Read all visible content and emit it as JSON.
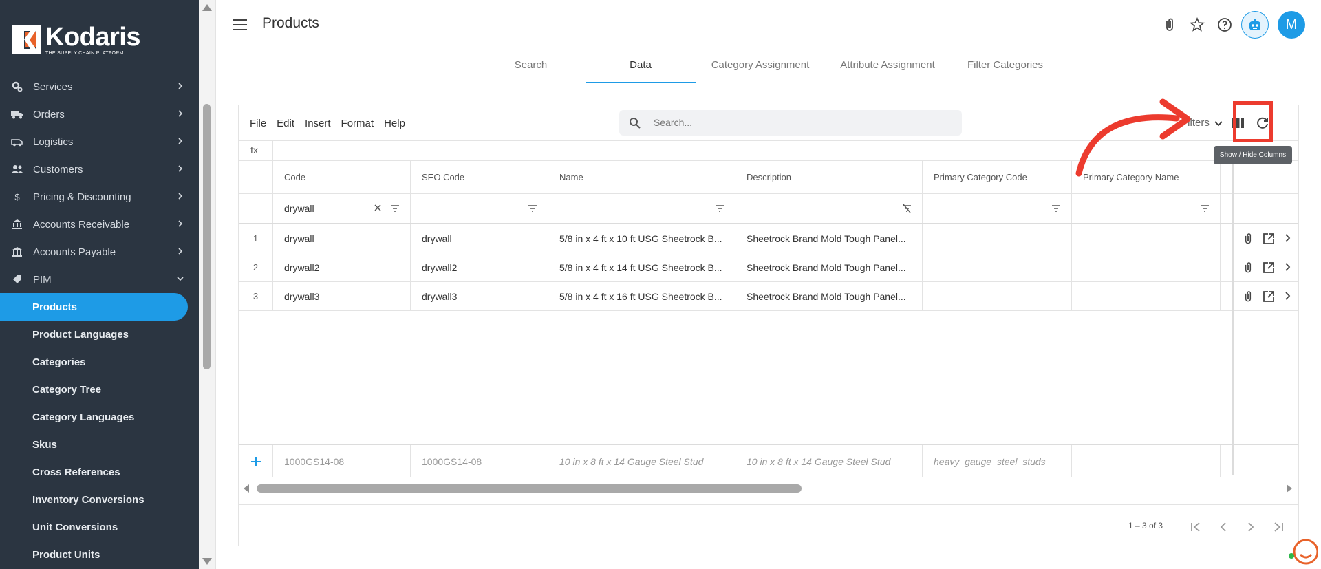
{
  "brand": {
    "name": "Kodaris",
    "tagline": "THE SUPPLY CHAIN PLATFORM"
  },
  "sidebar": {
    "items": [
      {
        "label": "Services",
        "icon": "gears-icon"
      },
      {
        "label": "Orders",
        "icon": "truck-icon"
      },
      {
        "label": "Logistics",
        "icon": "van-icon"
      },
      {
        "label": "Customers",
        "icon": "people-icon"
      },
      {
        "label": "Pricing & Discounting",
        "icon": "dollar-icon"
      },
      {
        "label": "Accounts Receivable",
        "icon": "bank-icon"
      },
      {
        "label": "Accounts Payable",
        "icon": "bank-icon"
      },
      {
        "label": "PIM",
        "icon": "tag-icon"
      }
    ],
    "subitems": [
      {
        "label": "Products",
        "active": true
      },
      {
        "label": "Product Languages"
      },
      {
        "label": "Categories"
      },
      {
        "label": "Category Tree"
      },
      {
        "label": "Category Languages"
      },
      {
        "label": "Skus"
      },
      {
        "label": "Cross References"
      },
      {
        "label": "Inventory Conversions"
      },
      {
        "label": "Unit Conversions"
      },
      {
        "label": "Product Units"
      }
    ]
  },
  "header": {
    "title": "Products",
    "avatar_initial": "M"
  },
  "tabs": [
    "Search",
    "Data",
    "Category Assignment",
    "Attribute Assignment",
    "Filter Categories"
  ],
  "toolbar": {
    "menu": [
      "File",
      "Edit",
      "Insert",
      "Format",
      "Help"
    ],
    "search_placeholder": "Search...",
    "filters_label": "Filters",
    "tooltip": "Show / Hide Columns",
    "fx": "fx"
  },
  "grid": {
    "columns": [
      "Code",
      "SEO Code",
      "Name",
      "Description",
      "Primary Category Code",
      "Primary Category Name"
    ],
    "filter_value": "drywall",
    "rows": [
      {
        "num": "1",
        "code": "drywall",
        "seo": "drywall",
        "name": "5/8 in x 4 ft x 10 ft USG Sheetrock B...",
        "desc": "Sheetrock Brand Mold Tough Panel...",
        "pcc": "",
        "pcn": ""
      },
      {
        "num": "2",
        "code": "drywall2",
        "seo": "drywall2",
        "name": "5/8 in x 4 ft x 14 ft USG Sheetrock B...",
        "desc": "Sheetrock Brand Mold Tough Panel...",
        "pcc": "",
        "pcn": ""
      },
      {
        "num": "3",
        "code": "drywall3",
        "seo": "drywall3",
        "name": "5/8 in x 4 ft x 16 ft USG Sheetrock B...",
        "desc": "Sheetrock Brand Mold Tough Panel...",
        "pcc": "",
        "pcn": ""
      }
    ],
    "new_row": {
      "code": "1000GS14-08",
      "seo": "1000GS14-08",
      "name": "10 in x 8 ft x 14 Gauge Steel Stud",
      "desc": "10 in x 8 ft x 14 Gauge Steel Stud",
      "pcc": "heavy_gauge_steel_studs",
      "pcn": ""
    },
    "pager": "1 – 3 of 3"
  },
  "colors": {
    "accent": "#1e9be6",
    "sidebar": "#2b3541",
    "highlight": "#ec3b2e"
  }
}
